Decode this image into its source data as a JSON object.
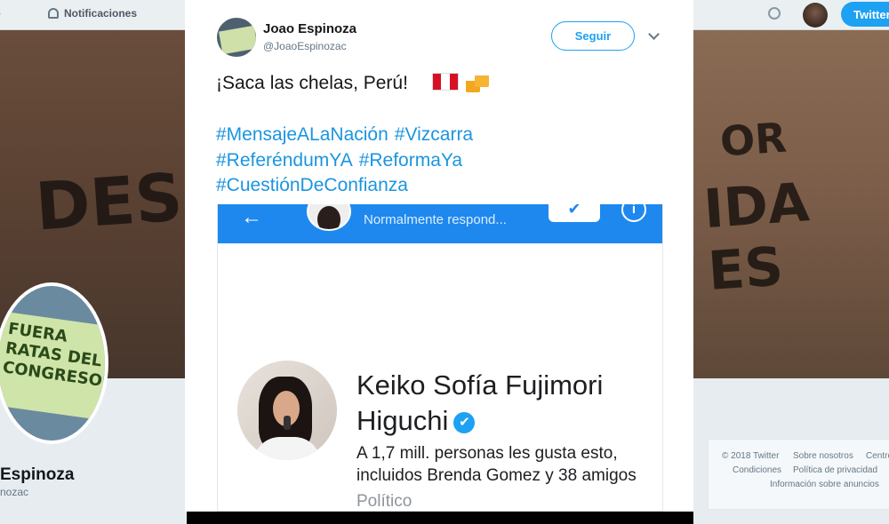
{
  "topbar": {
    "notifications_label": "Notificaciones",
    "tweet_button_label": "Twitter"
  },
  "background": {
    "left_graffiti": "DESI",
    "right_graffiti_1": "OR",
    "right_graffiti_2": "IDA ES"
  },
  "profile": {
    "sign_text": "FUERA RATAS DEL CONGRESO",
    "name": "Espinoza",
    "handle": "nozac"
  },
  "footer": {
    "links": [
      "© 2018 Twitter",
      "Sobre nosotros",
      "Centro",
      "Condiciones",
      "Política de privacidad",
      "Información sobre anuncios"
    ]
  },
  "tweet": {
    "author_name": "Joao Espinoza",
    "author_handle": "@JoaoEspinozac",
    "follow_label": "Seguir",
    "text": "¡Saca las chelas, Perú!",
    "hashtag_lines": [
      [
        "#MensajeALaNación",
        "#Vizcarra"
      ],
      [
        "#ReferéndumYA",
        "#ReformaYa"
      ],
      [
        "#CuestiónDeConfianza"
      ]
    ],
    "flag_colors": [
      "#d91023",
      "#ffffff",
      "#d91023"
    ]
  },
  "screenshot": {
    "status_text": "Normalmente respond...",
    "page_name_line1": "Keiko Sofía Fujimori",
    "page_name_line2": "Higuchi",
    "likes_text": "A 1,7 mill. personas les gusta esto, incluidos Brenda Gomez y 38 amigos",
    "category": "Político"
  },
  "colors": {
    "twitter_blue": "#1da1f2",
    "hashtag_blue": "#1b95e0",
    "messenger_blue": "#1e88ef"
  }
}
